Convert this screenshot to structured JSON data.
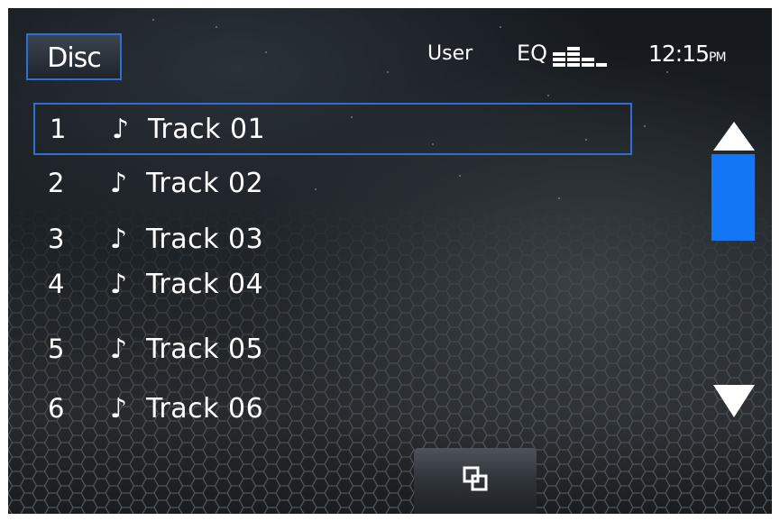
{
  "header": {
    "source_label": "Disc",
    "user_label": "User",
    "eq_label": "EQ",
    "clock_time": "12:15",
    "clock_ampm": "PM"
  },
  "tracks": [
    {
      "number": "1",
      "name": "Track 01",
      "icon": "music-note-icon",
      "selected": true
    },
    {
      "number": "2",
      "name": "Track 02",
      "icon": "music-note-icon",
      "selected": false
    },
    {
      "number": "3",
      "name": "Track 03",
      "icon": "music-note-icon",
      "selected": false
    },
    {
      "number": "4",
      "name": "Track 04",
      "icon": "music-note-icon",
      "selected": false
    },
    {
      "number": "5",
      "name": "Track 05",
      "icon": "music-note-icon",
      "selected": false
    },
    {
      "number": "6",
      "name": "Track 06",
      "icon": "music-note-icon",
      "selected": false
    }
  ],
  "icons": {
    "note_glyph": "♪",
    "eq": "equalizer-icon",
    "scroll_up": "arrow-up-icon",
    "scroll_down": "arrow-down-icon",
    "bottom_button": "browse-icon"
  },
  "colors": {
    "accent_blue": "#1376f5",
    "selection_border": "#2f6fd2",
    "text": "#ffffff"
  }
}
